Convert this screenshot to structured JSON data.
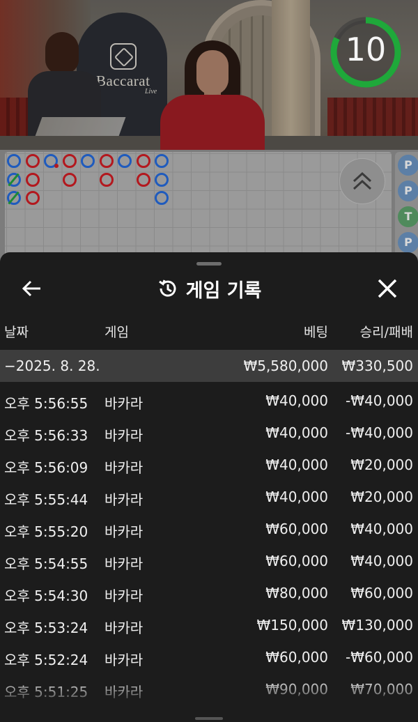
{
  "video": {
    "brand": "Baccarat",
    "brand_sub": "Live",
    "timer": "10",
    "timer_fraction": 0.82,
    "timer_color": "#1fa83a"
  },
  "roadmap": {
    "beads": [
      {
        "col": 0,
        "row": 0,
        "side": "P"
      },
      {
        "col": 0,
        "row": 1,
        "side": "P",
        "tie": true
      },
      {
        "col": 0,
        "row": 2,
        "side": "P",
        "tie": true
      },
      {
        "col": 1,
        "row": 0,
        "side": "B"
      },
      {
        "col": 1,
        "row": 1,
        "side": "B"
      },
      {
        "col": 1,
        "row": 2,
        "side": "B"
      },
      {
        "col": 2,
        "row": 0,
        "side": "P",
        "dot": true
      },
      {
        "col": 3,
        "row": 0,
        "side": "B"
      },
      {
        "col": 3,
        "row": 1,
        "side": "B"
      },
      {
        "col": 4,
        "row": 0,
        "side": "P"
      },
      {
        "col": 5,
        "row": 0,
        "side": "B"
      },
      {
        "col": 5,
        "row": 1,
        "side": "B"
      },
      {
        "col": 6,
        "row": 0,
        "side": "P"
      },
      {
        "col": 7,
        "row": 0,
        "side": "B"
      },
      {
        "col": 7,
        "row": 1,
        "side": "B"
      },
      {
        "col": 8,
        "row": 0,
        "side": "P"
      },
      {
        "col": 8,
        "row": 1,
        "side": "P"
      },
      {
        "col": 8,
        "row": 2,
        "side": "P"
      }
    ],
    "side_labels": [
      "P",
      "P",
      "T",
      "P"
    ],
    "colors": {
      "player": "#1f5bbd",
      "banker": "#b3181e",
      "tie": "#1d8a35"
    }
  },
  "sheet": {
    "title": "게임 기록",
    "back_icon": "arrow-left-icon",
    "history_icon": "history-icon",
    "close_icon": "close-icon",
    "columns": {
      "date": "날짜",
      "game": "게임",
      "bet": "베팅",
      "result": "승리/패배"
    },
    "summary": {
      "date": "−2025. 8. 28.",
      "bet": "₩5,580,000",
      "result": "₩330,500"
    },
    "rows": [
      {
        "time": "오후 5:56:55",
        "game": "바카라",
        "bet": "₩40,000",
        "result": "-₩40,000"
      },
      {
        "time": "오후 5:56:33",
        "game": "바카라",
        "bet": "₩40,000",
        "result": "-₩40,000"
      },
      {
        "time": "오후 5:56:09",
        "game": "바카라",
        "bet": "₩40,000",
        "result": "₩20,000"
      },
      {
        "time": "오후 5:55:44",
        "game": "바카라",
        "bet": "₩40,000",
        "result": "₩20,000"
      },
      {
        "time": "오후 5:55:20",
        "game": "바카라",
        "bet": "₩60,000",
        "result": "₩40,000"
      },
      {
        "time": "오후 5:54:55",
        "game": "바카라",
        "bet": "₩60,000",
        "result": "₩40,000"
      },
      {
        "time": "오후 5:54:30",
        "game": "바카라",
        "bet": "₩80,000",
        "result": "₩60,000"
      },
      {
        "time": "오후 5:53:24",
        "game": "바카라",
        "bet": "₩150,000",
        "result": "₩130,000"
      },
      {
        "time": "오후 5:52:24",
        "game": "바카라",
        "bet": "₩60,000",
        "result": "-₩60,000"
      },
      {
        "time": "오후 5:51:25",
        "game": "바카라",
        "bet": "₩90,000",
        "result": "₩70,000"
      }
    ]
  }
}
